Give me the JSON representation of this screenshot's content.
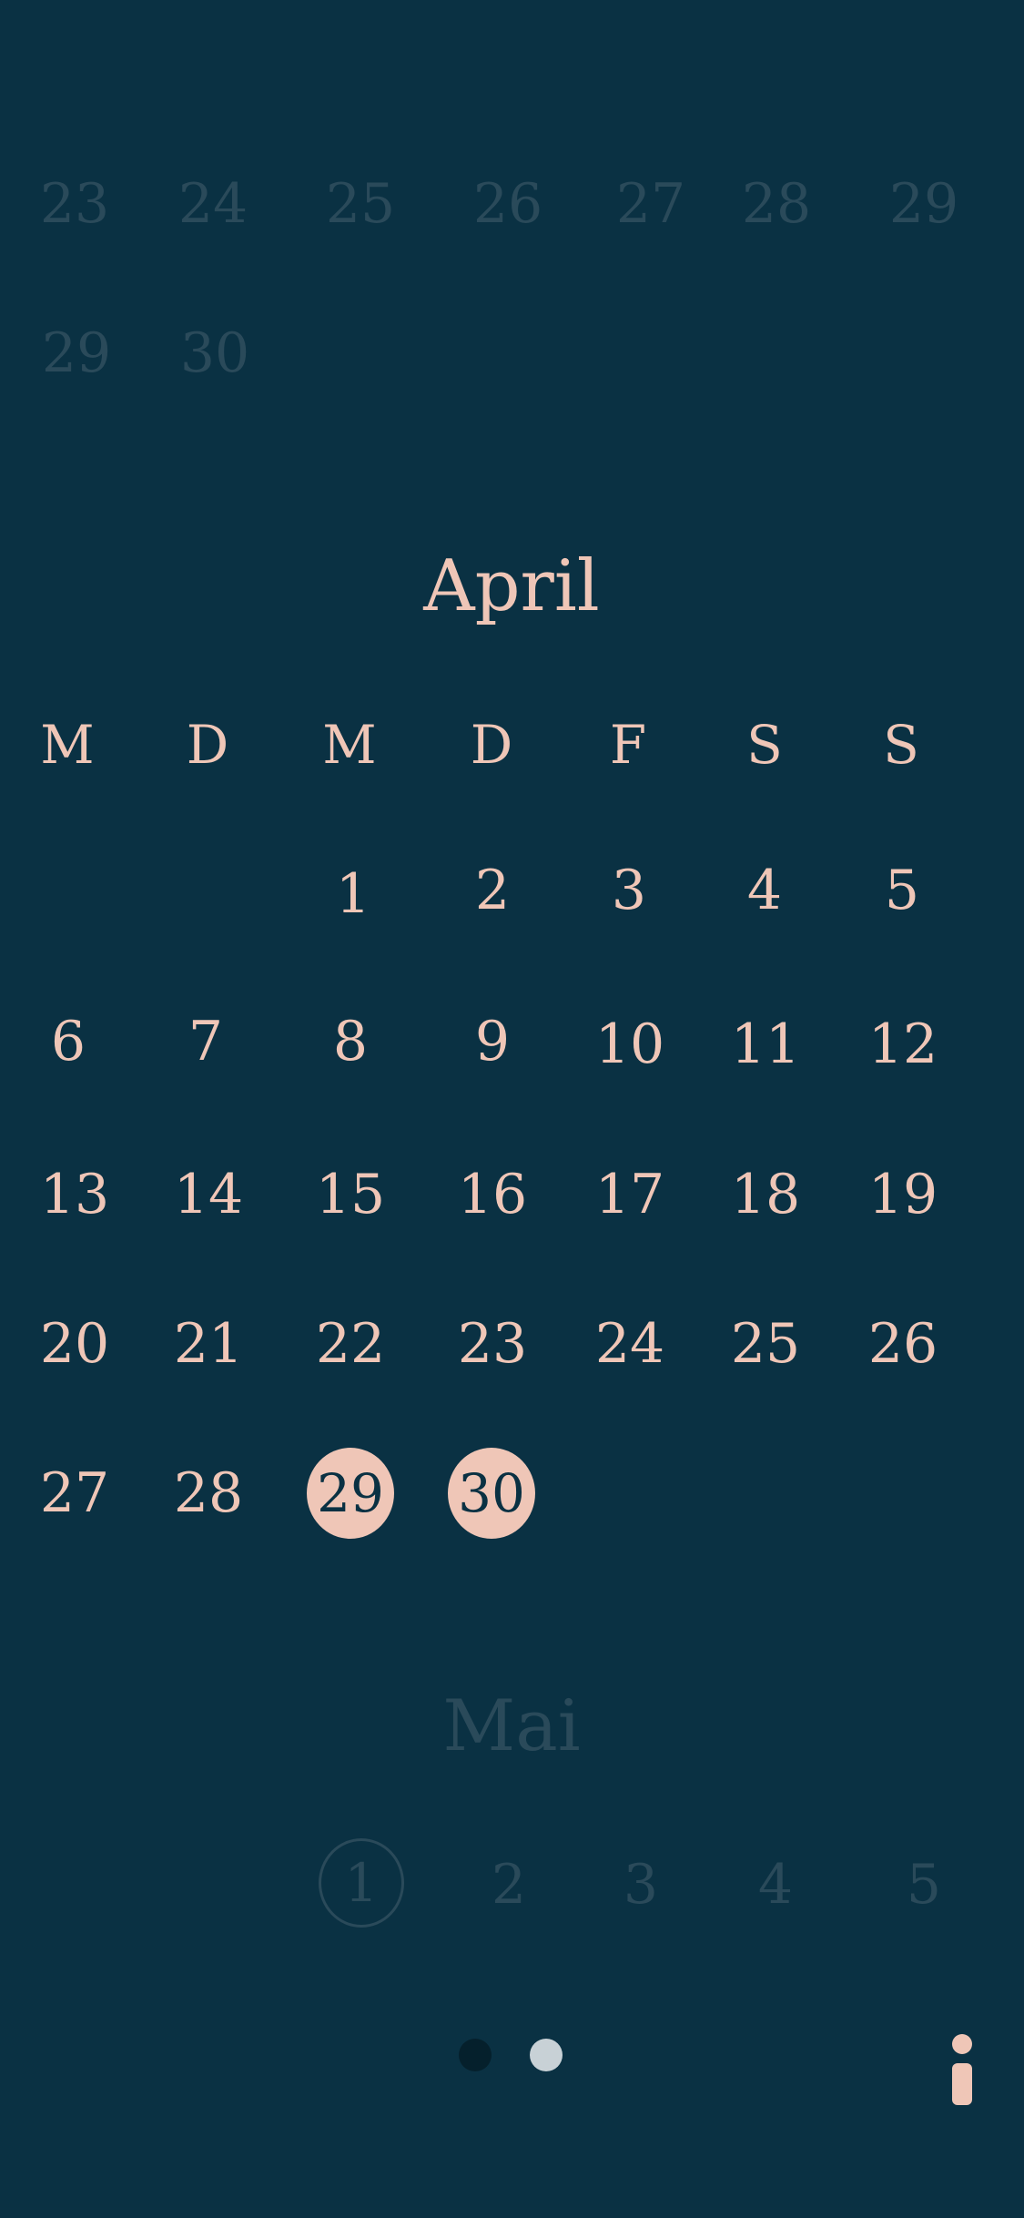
{
  "prev_month": {
    "row1": [
      "23",
      "24",
      "25",
      "26",
      "27",
      "28",
      "29"
    ],
    "row2": [
      "29",
      "30"
    ]
  },
  "current_month": {
    "title": "April",
    "weekdays": [
      "M",
      "D",
      "M",
      "D",
      "F",
      "S",
      "S"
    ],
    "weeks": [
      [
        "",
        "",
        "1",
        "2",
        "3",
        "4",
        "5"
      ],
      [
        "6",
        "7",
        "8",
        "9",
        "10",
        "11",
        "12"
      ],
      [
        "13",
        "14",
        "15",
        "16",
        "17",
        "18",
        "19"
      ],
      [
        "20",
        "21",
        "22",
        "23",
        "24",
        "25",
        "26"
      ],
      [
        "27",
        "28",
        "29",
        "30",
        "",
        "",
        ""
      ]
    ],
    "highlighted": [
      "29",
      "30"
    ]
  },
  "next_month": {
    "title": "Mai",
    "first_row": [
      "1",
      "2",
      "3",
      "4",
      "5"
    ],
    "ringed": "1"
  },
  "page_indicator": {
    "count": 2,
    "active_index": 1
  },
  "icons": {
    "info": "info-icon"
  },
  "colors": {
    "background": "#0a3143",
    "accent": "#efc6b7",
    "faded": "#2a4a5a",
    "dot_inactive": "#05202c",
    "dot_active": "#c8d1d6"
  }
}
